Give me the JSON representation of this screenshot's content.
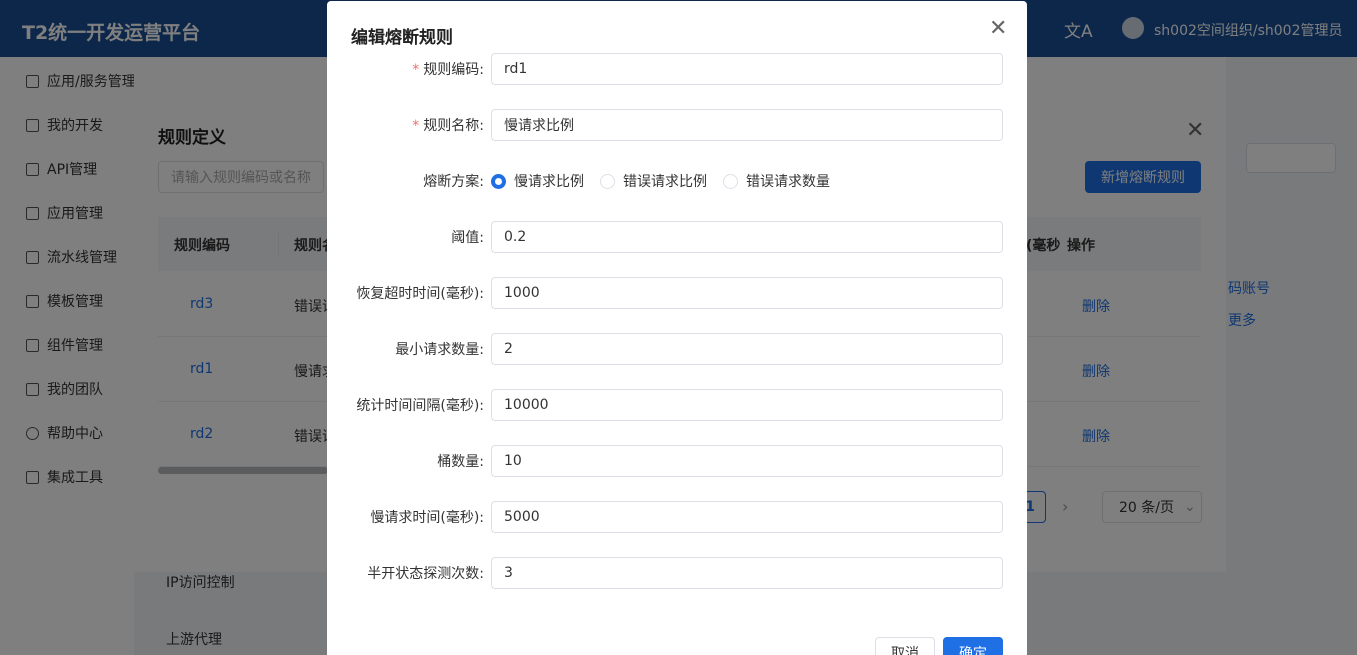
{
  "topbar": {
    "app_title": "T2统一开发运营平台",
    "lang_icon": "translate-icon",
    "user_name": "sh002空间组织/sh002管理员"
  },
  "sidebar": {
    "items": [
      {
        "label": "应用/服务管理",
        "icon": "grid-icon"
      },
      {
        "label": "我的开发",
        "icon": "code-icon"
      },
      {
        "label": "API管理",
        "icon": "link-icon"
      },
      {
        "label": "应用管理",
        "icon": "app-icon"
      },
      {
        "label": "流水线管理",
        "icon": "pipeline-icon"
      },
      {
        "label": "模板管理",
        "icon": "template-icon"
      },
      {
        "label": "组件管理",
        "icon": "component-icon"
      },
      {
        "label": "我的团队",
        "icon": "team-icon"
      },
      {
        "label": "帮助中心",
        "icon": "help-icon"
      },
      {
        "label": "集成工具",
        "icon": "folder-icon"
      }
    ]
  },
  "background": {
    "nav_items": [
      "IP访问控制",
      "上游代理"
    ],
    "right_links": [
      "码账号",
      "更多"
    ]
  },
  "rules_dialog": {
    "title": "规则定义",
    "search_placeholder": "请输入规则编码或名称",
    "add_button": "新增熔断规则",
    "columns": [
      "规则编码",
      "规则名",
      "(毫秒",
      "操作"
    ],
    "rows": [
      {
        "code": "rd3",
        "name": "错误请",
        "action": "删除"
      },
      {
        "code": "rd1",
        "name": "慢请求",
        "action": "删除"
      },
      {
        "code": "rd2",
        "name": "错误请",
        "action": "删除"
      }
    ],
    "page": "1",
    "page_size": "20 条/页"
  },
  "edit_dialog": {
    "title": "编辑熔断规则",
    "fields": [
      {
        "label": "规则编码:",
        "value": "rd1",
        "required": true
      },
      {
        "label": "规则名称:",
        "value": "慢请求比例",
        "required": true
      },
      {
        "label": "熔断方案:"
      },
      {
        "label": "阈值:",
        "value": "0.2"
      },
      {
        "label": "恢复超时时间(毫秒):",
        "value": "1000"
      },
      {
        "label": "最小请求数量:",
        "value": "2"
      },
      {
        "label": "统计时间间隔(毫秒):",
        "value": "10000"
      },
      {
        "label": "桶数量:",
        "value": "10"
      },
      {
        "label": "慢请求时间(毫秒):",
        "value": "5000"
      },
      {
        "label": "半开状态探测次数:",
        "value": "3"
      }
    ],
    "scheme_options": [
      "慢请求比例",
      "错误请求比例",
      "错误请求数量"
    ],
    "scheme_selected": "慢请求比例",
    "cancel_button": "取消",
    "ok_button": "确定",
    "accent_color": "#1f6fe5",
    "required_color": "#f56c6c"
  }
}
